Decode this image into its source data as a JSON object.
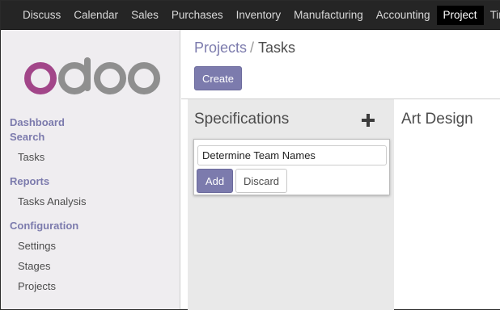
{
  "topbar": {
    "menu": [
      "Discuss",
      "Calendar",
      "Sales",
      "Purchases",
      "Inventory",
      "Manufacturing",
      "Accounting",
      "Project",
      "Time"
    ],
    "active": "Project"
  },
  "sidebar": {
    "logo_text": "odoo",
    "dashboard": "Dashboard",
    "search": "Search",
    "tasks": "Tasks",
    "reports": "Reports",
    "tasks_analysis": "Tasks Analysis",
    "configuration": "Configuration",
    "settings": "Settings",
    "stages": "Stages",
    "projects": "Projects"
  },
  "breadcrumb": {
    "parent": "Projects",
    "separator": "/",
    "current": "Tasks"
  },
  "control": {
    "create_label": "Create"
  },
  "kanban": {
    "column1": {
      "title": "Specifications",
      "plus_icon": "plus-icon",
      "quick_create": {
        "value": "Determine Team Names",
        "add_label": "Add",
        "discard_label": "Discard"
      }
    },
    "column2": {
      "title": "Art Design"
    }
  },
  "colors": {
    "brand": "#7c7bad",
    "navbar": "#252525",
    "sidebar": "#efedf0",
    "logo_purple": "#a24689",
    "logo_gray": "#8f8f8f"
  }
}
